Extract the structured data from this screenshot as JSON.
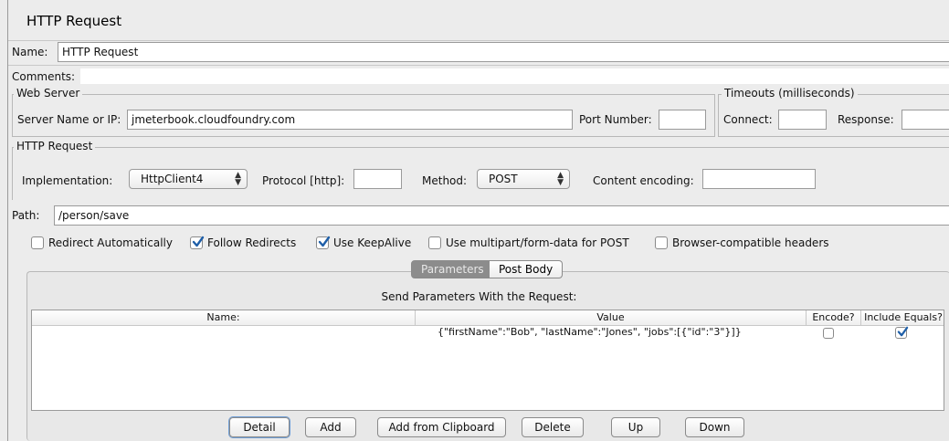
{
  "window": {
    "title": "HTTP Request"
  },
  "name_field": {
    "label": "Name:",
    "value": "HTTP Request"
  },
  "comments": {
    "label": "Comments:",
    "value": ""
  },
  "web_server": {
    "legend": "Web Server",
    "server_label": "Server Name or IP:",
    "server_value": "jmeterbook.cloudfoundry.com",
    "port_label": "Port Number:",
    "port_value": ""
  },
  "timeouts": {
    "legend": "Timeouts (milliseconds)",
    "connect_label": "Connect:",
    "connect_value": "",
    "response_label": "Response:",
    "response_value": ""
  },
  "http_request": {
    "legend": "HTTP Request",
    "implementation_label": "Implementation:",
    "implementation_value": "HttpClient4",
    "protocol_label": "Protocol [http]:",
    "protocol_value": "",
    "method_label": "Method:",
    "method_value": "POST",
    "encoding_label": "Content encoding:",
    "encoding_value": ""
  },
  "path": {
    "label": "Path:",
    "value": "/person/save"
  },
  "options": [
    {
      "label": "Redirect Automatically",
      "checked": false
    },
    {
      "label": "Follow Redirects",
      "checked": true
    },
    {
      "label": "Use KeepAlive",
      "checked": true
    },
    {
      "label": "Use multipart/form-data for POST",
      "checked": false
    },
    {
      "label": "Browser-compatible headers",
      "checked": false
    }
  ],
  "tabs": [
    {
      "label": "Parameters",
      "active": true
    },
    {
      "label": "Post Body",
      "active": false
    }
  ],
  "params": {
    "caption": "Send Parameters With the Request:",
    "columns": [
      "Name:",
      "Value",
      "Encode?",
      "Include Equals?"
    ],
    "rows": [
      {
        "name": "",
        "value": "{\"firstName\":\"Bob\", \"lastName\":\"Jones\", \"jobs\":[{\"id\":\"3\"}]}",
        "encode": false,
        "include_equals": true
      }
    ]
  },
  "buttons": {
    "detail": "Detail",
    "add": "Add",
    "add_clipboard": "Add from Clipboard",
    "delete": "Delete",
    "up": "Up",
    "down": "Down"
  },
  "icons": {
    "updown_arrows": "⌃\n⌄",
    "checkmark": "checkmark-icon"
  },
  "colors": {
    "active_tab": "#8c8c8c",
    "check": "#1f5fa8",
    "background": "#ececec"
  }
}
